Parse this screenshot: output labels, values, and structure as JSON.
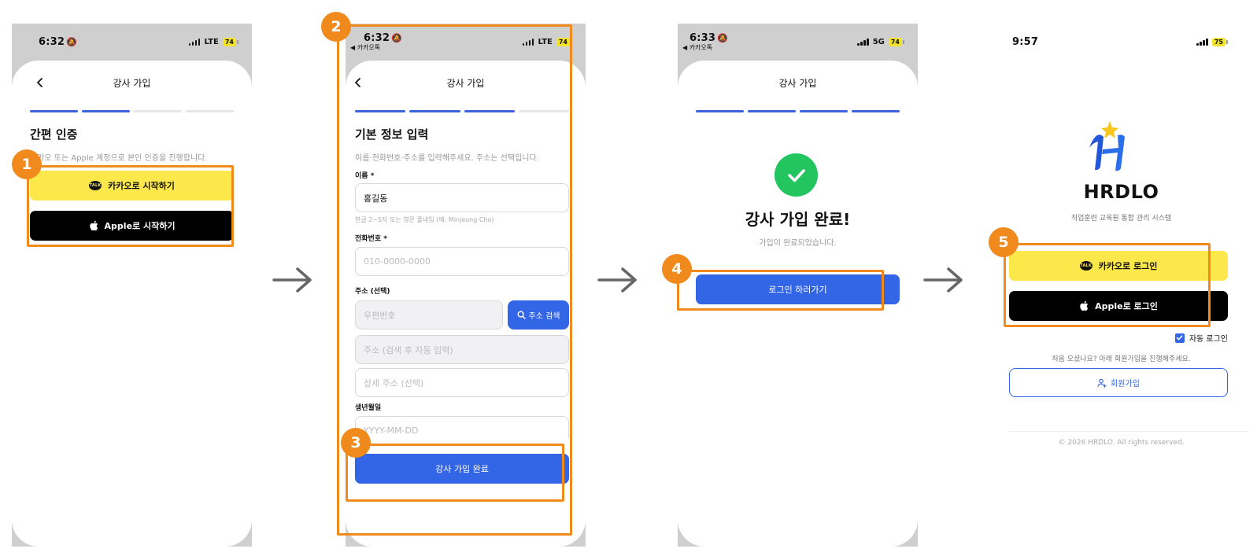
{
  "screens": [
    {
      "time": "6:32",
      "sub": "",
      "network": "LTE",
      "battery": "74",
      "header": "강사 가입",
      "steps": [
        true,
        true,
        false,
        false
      ],
      "section_title": "간편 인증",
      "section_desc": "카카오 또는 Apple 계정으로 본인 인증을 진행합니다.",
      "kakao_button": "카카오로 시작하기",
      "apple_button": "Apple로 시작하기",
      "badge": "1"
    },
    {
      "time": "6:32",
      "sub": "◀ 카카오톡",
      "network": "LTE",
      "battery": "74",
      "header": "강사 가입",
      "steps": [
        true,
        true,
        true,
        false
      ],
      "section_title": "기본 정보 입력",
      "section_desc": "이름·전화번호·주소를 입력해주세요. 주소는 선택입니다.",
      "name_label": "이름 *",
      "name_value": "홍길동",
      "name_hint": "한글 2~5자 또는 영문 풀네임 (예: Minjeong Cho)",
      "phone_label": "전화번호 *",
      "phone_placeholder": "010-0000-0000",
      "address_label": "주소 (선택)",
      "zip_placeholder": "우편번호",
      "search_button": "주소 검색",
      "address_placeholder": "주소 (검색 후 자동 입력)",
      "detail_placeholder": "상세 주소 (선택)",
      "birth_label": "생년월일",
      "birth_placeholder": "YYYY-MM-DD",
      "submit_button": "강사 가입 완료",
      "badge": "2",
      "badge2": "3"
    },
    {
      "time": "6:33",
      "sub": "◀ 카카오톡",
      "network": "5G",
      "battery": "74",
      "header": "강사 가입",
      "steps": [
        true,
        true,
        true,
        true
      ],
      "done_title": "강사 가입 완료!",
      "done_desc": "가입이 완료되었습니다.",
      "login_button": "로그인 하러가기",
      "badge": "4"
    },
    {
      "time": "9:57",
      "battery": "75",
      "brand": "HRDLO",
      "tagline": "직업훈련 교육원 통합 관리 시스템",
      "kakao_login": "카카오로 로그인",
      "apple_login": "Apple로 로그인",
      "auto_login": "자동 로그인",
      "first_visit": "처음 오셨나요? 아래 회원가입을 진행해주세요.",
      "signup_button": "회원가입",
      "copyright": "© 2026 HRDLO. All rights reserved.",
      "badge": "5"
    }
  ],
  "icons": {
    "back": "chevron-left-icon",
    "bell": "bell-slash-icon",
    "search": "search-icon",
    "check": "check-icon",
    "user_add": "user-add-icon",
    "arrow": "arrow-right-icon"
  },
  "colors": {
    "highlight": "#f08a1d",
    "kakao": "#fde84b",
    "primary": "#3366e6",
    "step_active": "#3d63dd",
    "success": "#22c55e"
  }
}
